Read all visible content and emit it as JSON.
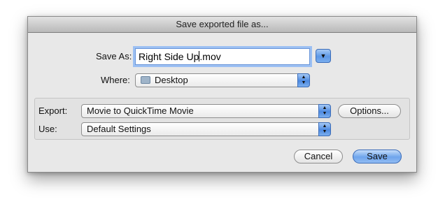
{
  "dialog": {
    "title": "Save exported file as..."
  },
  "save_as": {
    "label": "Save As:",
    "value_before_caret": "Right Side Up",
    "value_after_caret": ".mov"
  },
  "where": {
    "label": "Where:",
    "value": "Desktop"
  },
  "export": {
    "label": "Export:",
    "value": "Movie to QuickTime Movie",
    "options_label": "Options..."
  },
  "use": {
    "label": "Use:",
    "value": "Default Settings"
  },
  "buttons": {
    "cancel": "Cancel",
    "save": "Save"
  },
  "icons": {
    "disclosure": "triangle-down-icon",
    "folder": "folder-icon",
    "popup_arrows": "up-down-arrows-icon"
  },
  "colors": {
    "accent": "#5d98e6",
    "dialog_bg": "#e8e8e8"
  }
}
